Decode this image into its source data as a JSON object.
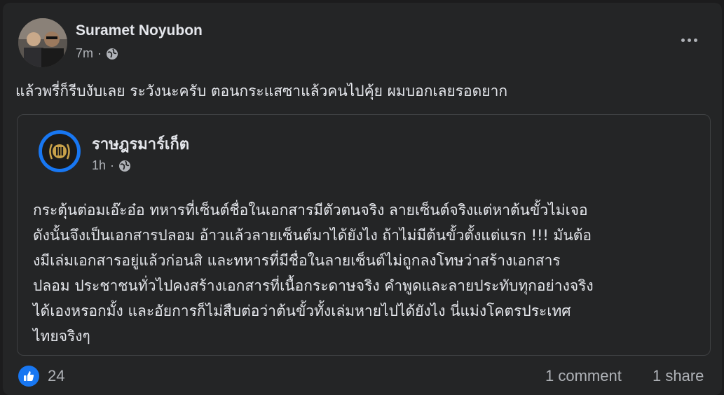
{
  "post": {
    "author": "Suramet Noyubon",
    "time": "7m",
    "separator": "·",
    "privacy_icon": "globe-icon",
    "text": "แล้วพรี่ก็รีบงับเลย ระวังนะครับ ตอนกระแสซาแล้วคนไปคุ้ย ผมบอกเลยรอดยาก",
    "more_icon": "more-options-icon"
  },
  "shared_post": {
    "page_name": "ราษฎรมาร์เก็ต",
    "time": "1h",
    "separator": "·",
    "privacy_icon": "globe-icon",
    "lines": [
      "กระตุ้นต่อมเอ๊ะอ๋อ ทหารที่เซ็นต์ชื่อในเอกสารมีตัวตนจริง ลายเซ็นต์จริงแต่หาต้นขั้วไม่เจอ",
      "ดังนั้นจึงเป็นเอกสารปลอม  อ้าวแล้วลายเซ็นต์มาได้ยังไง ถ้าไม่มีต้นขั้วตั้งแต่แรก !!! มันต้อ",
      "งมีเล่มเอกสารอยู่แล้วก่อนสิ และทหารที่มีชื่อในลายเซ็นต์ไม่ถูกลงโทษว่าสร้างเอกสาร",
      "ปลอม ประชาชนทั่วไปคงสร้างเอกสารที่เนื้อกระดาษจริง คำพูดและลายประทับทุกอย่างจริง",
      "ได้เองหรอกมั้ง และอัยการก็ไม่สืบต่อว่าต้นขั้วทั้งเล่มหายไปได้ยังไง นี่แม่งโคตรประเทศ",
      "ไทยจริงๆ"
    ]
  },
  "footer": {
    "reaction_icon": "like-icon",
    "reaction_count": "24",
    "comments": "1 comment",
    "shares": "1 share"
  },
  "colors": {
    "background": "#242526",
    "text": "#e4e6eb",
    "secondary": "#b0b3b8",
    "accent": "#1877f2",
    "border": "#3e4042"
  }
}
